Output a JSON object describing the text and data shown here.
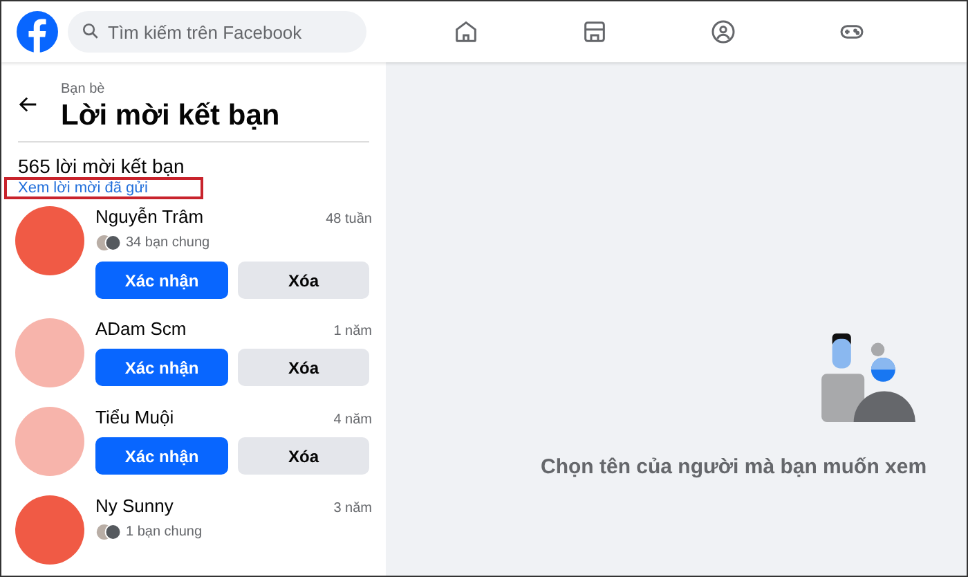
{
  "header": {
    "search": {
      "placeholder": "Tìm kiếm trên Facebook"
    },
    "nav": [
      {
        "kind": "home"
      },
      {
        "kind": "store"
      },
      {
        "kind": "groups"
      },
      {
        "kind": "gaming"
      }
    ]
  },
  "panel": {
    "breadcrumb": "Bạn bè",
    "title": "Lời mời kết bạn",
    "count": "565 lời mời kết bạn",
    "sent_link": "Xem lời mời đã gửi",
    "requests": [
      {
        "name": "Nguyễn Trâm",
        "time": "48 tuần",
        "mutual": "34 bạn chung",
        "color": "#f05a45",
        "confirm": "Xác nhận",
        "delete": "Xóa"
      },
      {
        "name": "ADam Scm",
        "time": "1 năm",
        "color": "#f7b4ab",
        "confirm": "Xác nhận",
        "delete": "Xóa"
      },
      {
        "name": "Tiểu Muội",
        "time": "4 năm",
        "color": "#f7b4ab",
        "confirm": "Xác nhận",
        "delete": "Xóa"
      },
      {
        "name": "Ny Sunny",
        "time": "3 năm",
        "mutual": "1 bạn chung",
        "color": "#f05a45"
      }
    ]
  },
  "empty_state": {
    "message": "Chọn tên của người mà bạn muốn xem"
  }
}
